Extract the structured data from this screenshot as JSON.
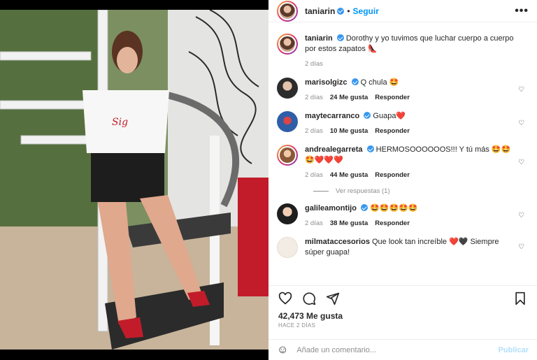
{
  "post": {
    "username": "taniarin",
    "follow_label": "Seguir",
    "more_label": "•••",
    "caption": "Dorothy y yo tuvimos que luchar cuerpo a cuerpo por estos zapatos 👠",
    "caption_age": "2 días"
  },
  "comments": [
    {
      "user": "marisolgizc",
      "verified": true,
      "text": "Q chula 🤩",
      "age": "2 días",
      "likes": "24 Me gusta",
      "reply": "Responder"
    },
    {
      "user": "maytecarranco",
      "verified": true,
      "text": "Guapa❤️",
      "age": "2 días",
      "likes": "10 Me gusta",
      "reply": "Responder"
    },
    {
      "user": "andrealegarreta",
      "verified": true,
      "text": "HERMOSOOOOOOS!!! Y tú más 🤩🤩🤩❤️❤️❤️",
      "age": "2 días",
      "likes": "44 Me gusta",
      "reply": "Responder"
    },
    {
      "user": "galileamontijo",
      "verified": true,
      "text": "🤩🤩🤩🤩🤩",
      "age": "2 días",
      "likes": "38 Me gusta",
      "reply": "Responder"
    },
    {
      "user": "milmataccesorios",
      "verified": false,
      "text": "Que look tan increíble ❤️🖤 Siempre súper guapa!",
      "age": "",
      "likes": "",
      "reply": ""
    }
  ],
  "view_replies": "Ver respuestas (1)",
  "likes_count": "42,473 Me gusta",
  "posted_ago": "HACE 2 DÍAS",
  "composer": {
    "placeholder": "Añade un comentario...",
    "post_label": "Publicar"
  },
  "colors": {
    "accent": "#0095f6",
    "muted": "#8e8e8e"
  }
}
